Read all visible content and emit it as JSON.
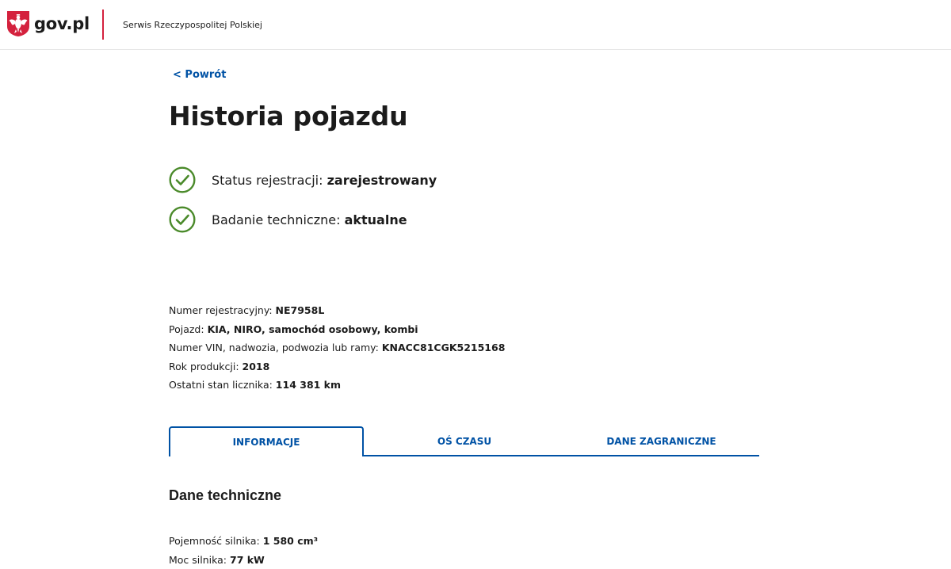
{
  "header": {
    "logo_text": "gov.pl",
    "service_name": "Serwis Rzeczypospolitej Polskiej",
    "emblem_icon": "polish-eagle-emblem-icon",
    "accent_color": "#d4213d"
  },
  "back_link": "< Powrót",
  "title": "Historia pojazdu",
  "statuses": [
    {
      "label": "Status rejestracji: ",
      "value": "zarejestrowany",
      "icon": "check-circle-icon",
      "color": "#4a8a2a"
    },
    {
      "label": "Badanie techniczne: ",
      "value": "aktualne",
      "icon": "check-circle-icon",
      "color": "#4a8a2a"
    }
  ],
  "vehicle": [
    {
      "label": "Numer rejestracyjny: ",
      "value": "NE7958L"
    },
    {
      "label": "Pojazd: ",
      "value": "KIA, NIRO, samochód osobowy, kombi"
    },
    {
      "label": "Numer VIN, nadwozia, podwozia lub ramy: ",
      "value": "KNACC81CGK5215168"
    },
    {
      "label": "Rok produkcji: ",
      "value": "2018"
    },
    {
      "label": "Ostatni stan licznika: ",
      "value": "114 381 km"
    }
  ],
  "tabs": [
    {
      "label": "INFORMACJE",
      "active": true
    },
    {
      "label": "OŚ CZASU",
      "active": false
    },
    {
      "label": "DANE ZAGRANICZNE",
      "active": false
    }
  ],
  "tab_color": "#0052a5",
  "section_title": "Dane techniczne",
  "technical": [
    {
      "label": "Pojemność silnika: ",
      "value": "1 580 cm³"
    },
    {
      "label": "Moc silnika: ",
      "value": "77 kW"
    }
  ]
}
